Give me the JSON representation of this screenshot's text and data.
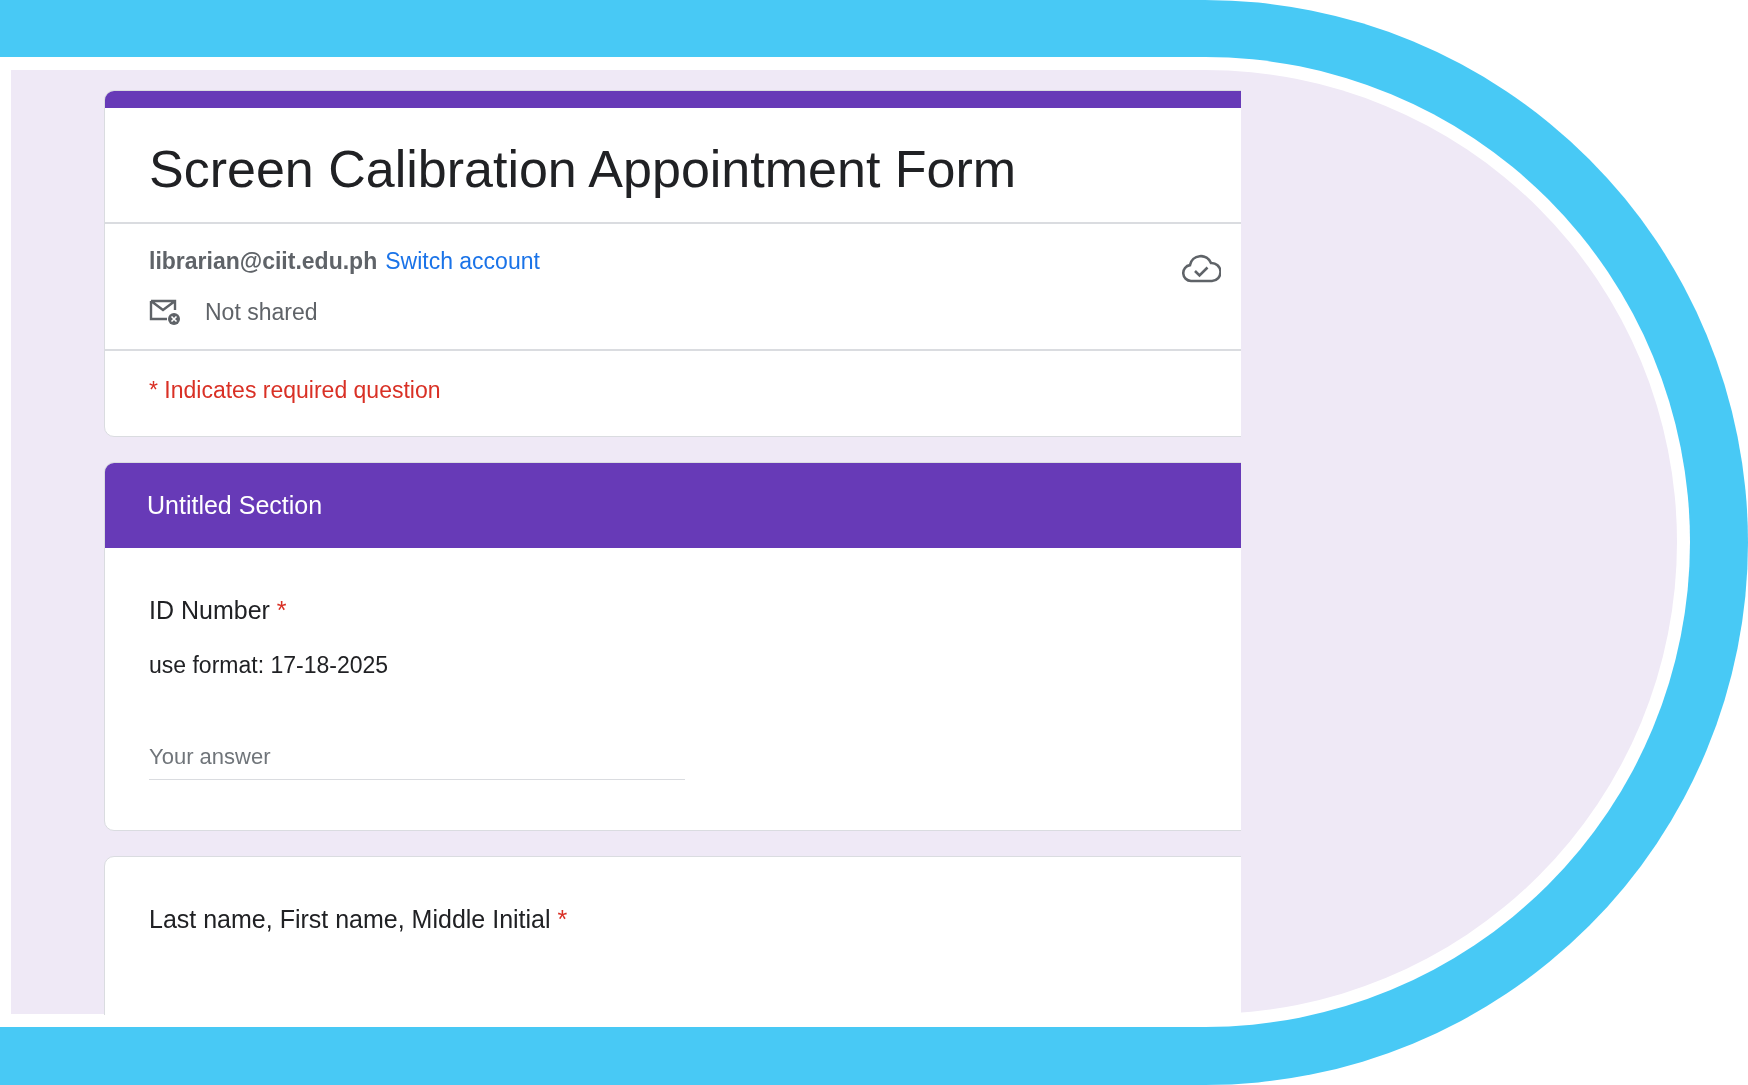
{
  "form": {
    "title": "Screen Calibration Appointment Form",
    "account": {
      "email": "librarian@ciit.edu.ph",
      "switch_link": "Switch account"
    },
    "sharing": "Not shared",
    "required_note": "* Indicates required question"
  },
  "section": {
    "title": "Untitled Section"
  },
  "questions": [
    {
      "title": "ID Number",
      "required_mark": "*",
      "description": "use format: 17-18-2025",
      "answer": {
        "placeholder": "Your answer"
      }
    },
    {
      "title": "Last name, First name, Middle Initial",
      "required_mark": "*"
    }
  ]
}
